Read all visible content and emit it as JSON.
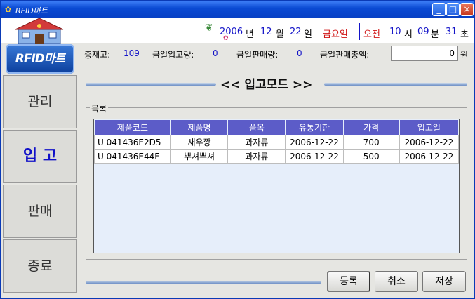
{
  "window": {
    "title": "RFID마트"
  },
  "header": {
    "year": "2006",
    "year_unit": "년",
    "month": "12",
    "month_unit": "월",
    "day": "22",
    "day_unit": "일",
    "weekday": "금요일",
    "ampm": "오전",
    "hour": "10",
    "hour_unit": "시",
    "minute": "09",
    "minute_unit": "분",
    "second": "31",
    "second_unit": "초"
  },
  "sidebar": {
    "logo": "RFID마트",
    "items": [
      {
        "label": "관리"
      },
      {
        "label": "입 고"
      },
      {
        "label": "판매"
      },
      {
        "label": "종료"
      }
    ]
  },
  "stats": {
    "total_stock_label": "총재고:",
    "total_stock": "109",
    "today_in_label": "금일입고량:",
    "today_in": "0",
    "today_sales_label": "금일판매량:",
    "today_sales": "0",
    "today_total_label": "금일판매총액:",
    "today_total": "0",
    "currency": "원"
  },
  "mode": {
    "title": "<< 입고모드 >>"
  },
  "list": {
    "legend": "목록",
    "columns": [
      "제품코드",
      "제품명",
      "품목",
      "유통기한",
      "가격",
      "입고일"
    ],
    "rows": [
      [
        "U 041436E2D5",
        "새우깡",
        "과자류",
        "2006-12-22",
        "700",
        "2006-12-22"
      ],
      [
        "U 041436E44F",
        "뿌셔뿌셔",
        "과자류",
        "2006-12-22",
        "500",
        "2006-12-22"
      ]
    ]
  },
  "buttons": {
    "register": "등록",
    "cancel": "취소",
    "save": "저장"
  }
}
